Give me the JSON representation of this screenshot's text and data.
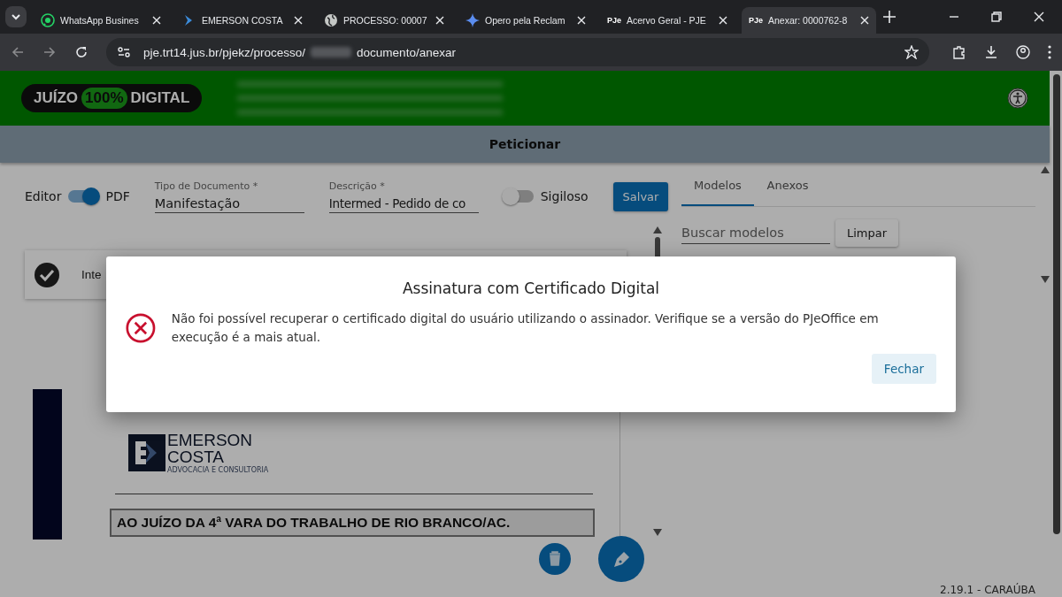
{
  "browser": {
    "tabs": [
      {
        "title": "WhatsApp Busines",
        "kind": "whatsapp",
        "selected": false
      },
      {
        "title": "EMERSON COSTA",
        "kind": "chevron",
        "selected": false
      },
      {
        "title": "PROCESSO: 00007",
        "kind": "globe",
        "selected": false
      },
      {
        "title": "Opero pela Reclam",
        "kind": "sparkle",
        "selected": false
      },
      {
        "title": "Acervo Geral - PJE",
        "kind": "pje",
        "favicon_text": "PJe",
        "selected": false
      },
      {
        "title": "Anexar: 0000762-8",
        "kind": "pje",
        "favicon_text": "PJe",
        "selected": true
      }
    ],
    "url_start": "pje.trt14.jus.br/pjekz/processo/",
    "url_end": "documento/anexar"
  },
  "header": {
    "logo": [
      "JUÍZO",
      "100%",
      "DIGITAL"
    ]
  },
  "title_bar": "Peticionar",
  "form": {
    "mode_left": "Editor",
    "mode_right": "PDF",
    "pdf_on": true,
    "type_label": "Tipo de Documento *",
    "type_value": "Manifestação",
    "desc_label": "Descrição *",
    "desc_value": "Intermed - Pedido de co",
    "secret_label": "Sigiloso",
    "secret_on": false,
    "save": "Salvar"
  },
  "item": {
    "text": "Inte",
    "done": true
  },
  "document": {
    "brand": [
      "EMERSON",
      "COSTA",
      "ADVOCACIA E CONSULTORIA"
    ],
    "heading": "AO JUÍZO DA 4ª VARA DO TRABALHO DE RIO BRANCO/AC."
  },
  "side_panel": {
    "tabs": [
      {
        "label": "Modelos",
        "selected": true
      },
      {
        "label": "Anexos",
        "selected": false
      }
    ],
    "search_placeholder": "Buscar modelos",
    "clear": "Limpar"
  },
  "version": "2.19.1 - CARAÚBA",
  "dialog": {
    "title": "Assinatura com Certificado Digital",
    "kind": "error",
    "message": "Não foi possível recuperar o certificado digital do usuário utilizando o assinador. Verifique se a versão do PJeOffice em execução é a mais atual.",
    "button": "Fechar"
  }
}
